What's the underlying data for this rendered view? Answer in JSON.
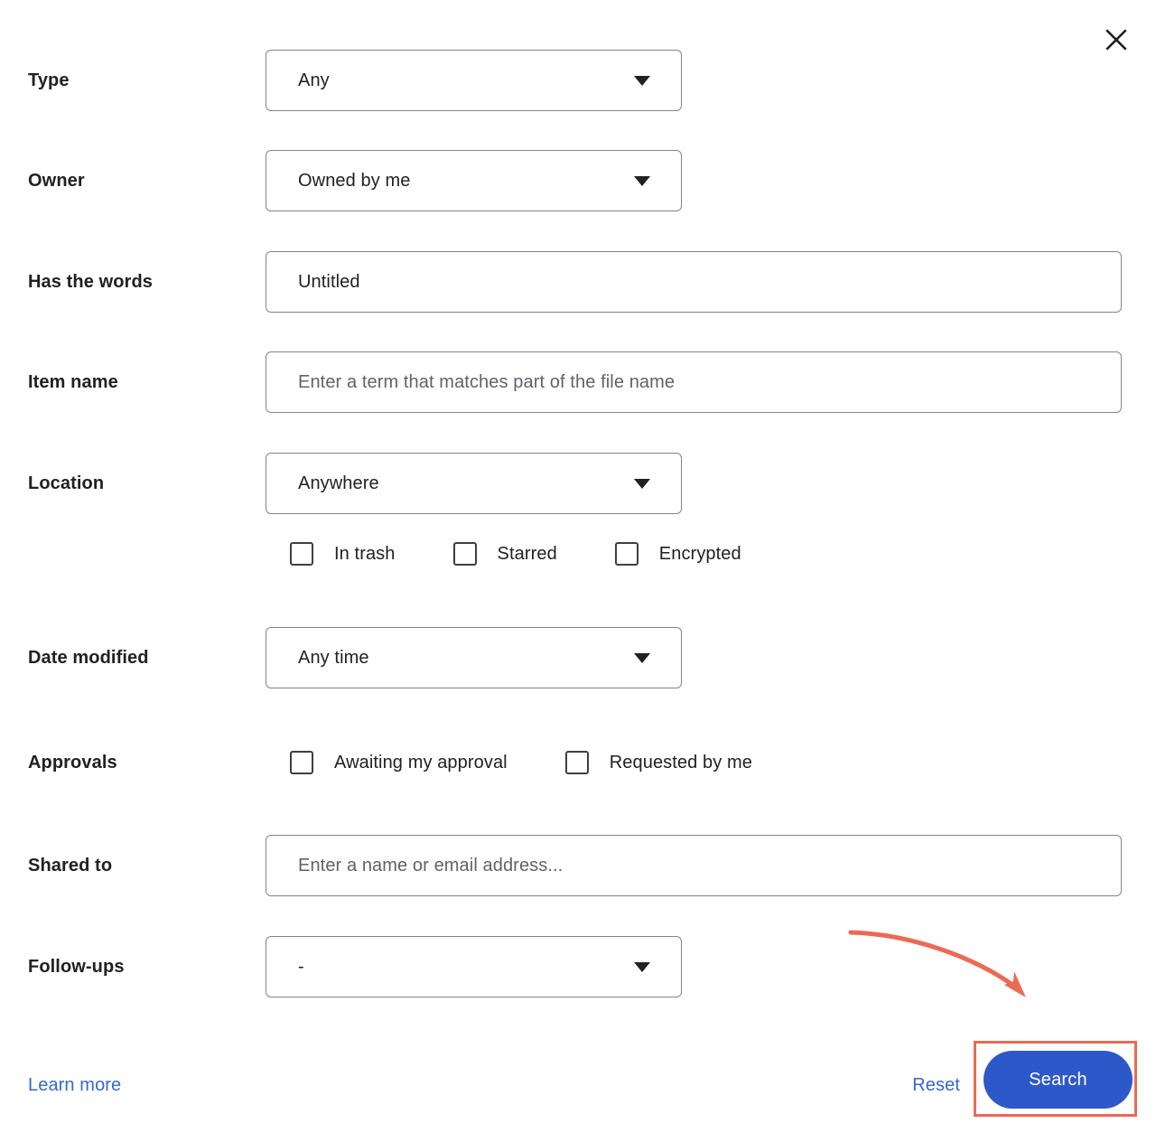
{
  "dialog": {
    "close_icon": "close-icon"
  },
  "rows": [
    {
      "label": "Type",
      "control": "select",
      "value": "Any"
    },
    {
      "label": "Owner",
      "control": "select",
      "value": "Owned by me"
    },
    {
      "label": "Has the words",
      "control": "text",
      "value": "Untitled",
      "placeholder": ""
    },
    {
      "label": "Item name",
      "control": "text",
      "value": "",
      "placeholder": "Enter a term that matches part of the file name"
    },
    {
      "label": "Location",
      "control": "select",
      "value": "Anywhere"
    },
    {
      "label": "Date modified",
      "control": "select",
      "value": "Any time"
    },
    {
      "label": "Approvals",
      "control": "checkboxes"
    },
    {
      "label": "Shared to",
      "control": "text",
      "value": "",
      "placeholder": "Enter a name or email address..."
    },
    {
      "label": "Follow-ups",
      "control": "select",
      "value": "-"
    }
  ],
  "location_checkboxes": [
    {
      "label": "In trash",
      "checked": false
    },
    {
      "label": "Starred",
      "checked": false
    },
    {
      "label": "Encrypted",
      "checked": false
    }
  ],
  "approval_checkboxes": [
    {
      "label": "Awaiting my approval",
      "checked": false
    },
    {
      "label": "Requested by me",
      "checked": false
    }
  ],
  "footer": {
    "learn_more": "Learn more",
    "reset": "Reset",
    "search": "Search"
  },
  "colors": {
    "accent_blue": "#2d58c9",
    "link_blue": "#3367d6",
    "annotation": "#ec6a53",
    "border": "#80868b",
    "text": "#202124",
    "placeholder": "#5f6368"
  }
}
